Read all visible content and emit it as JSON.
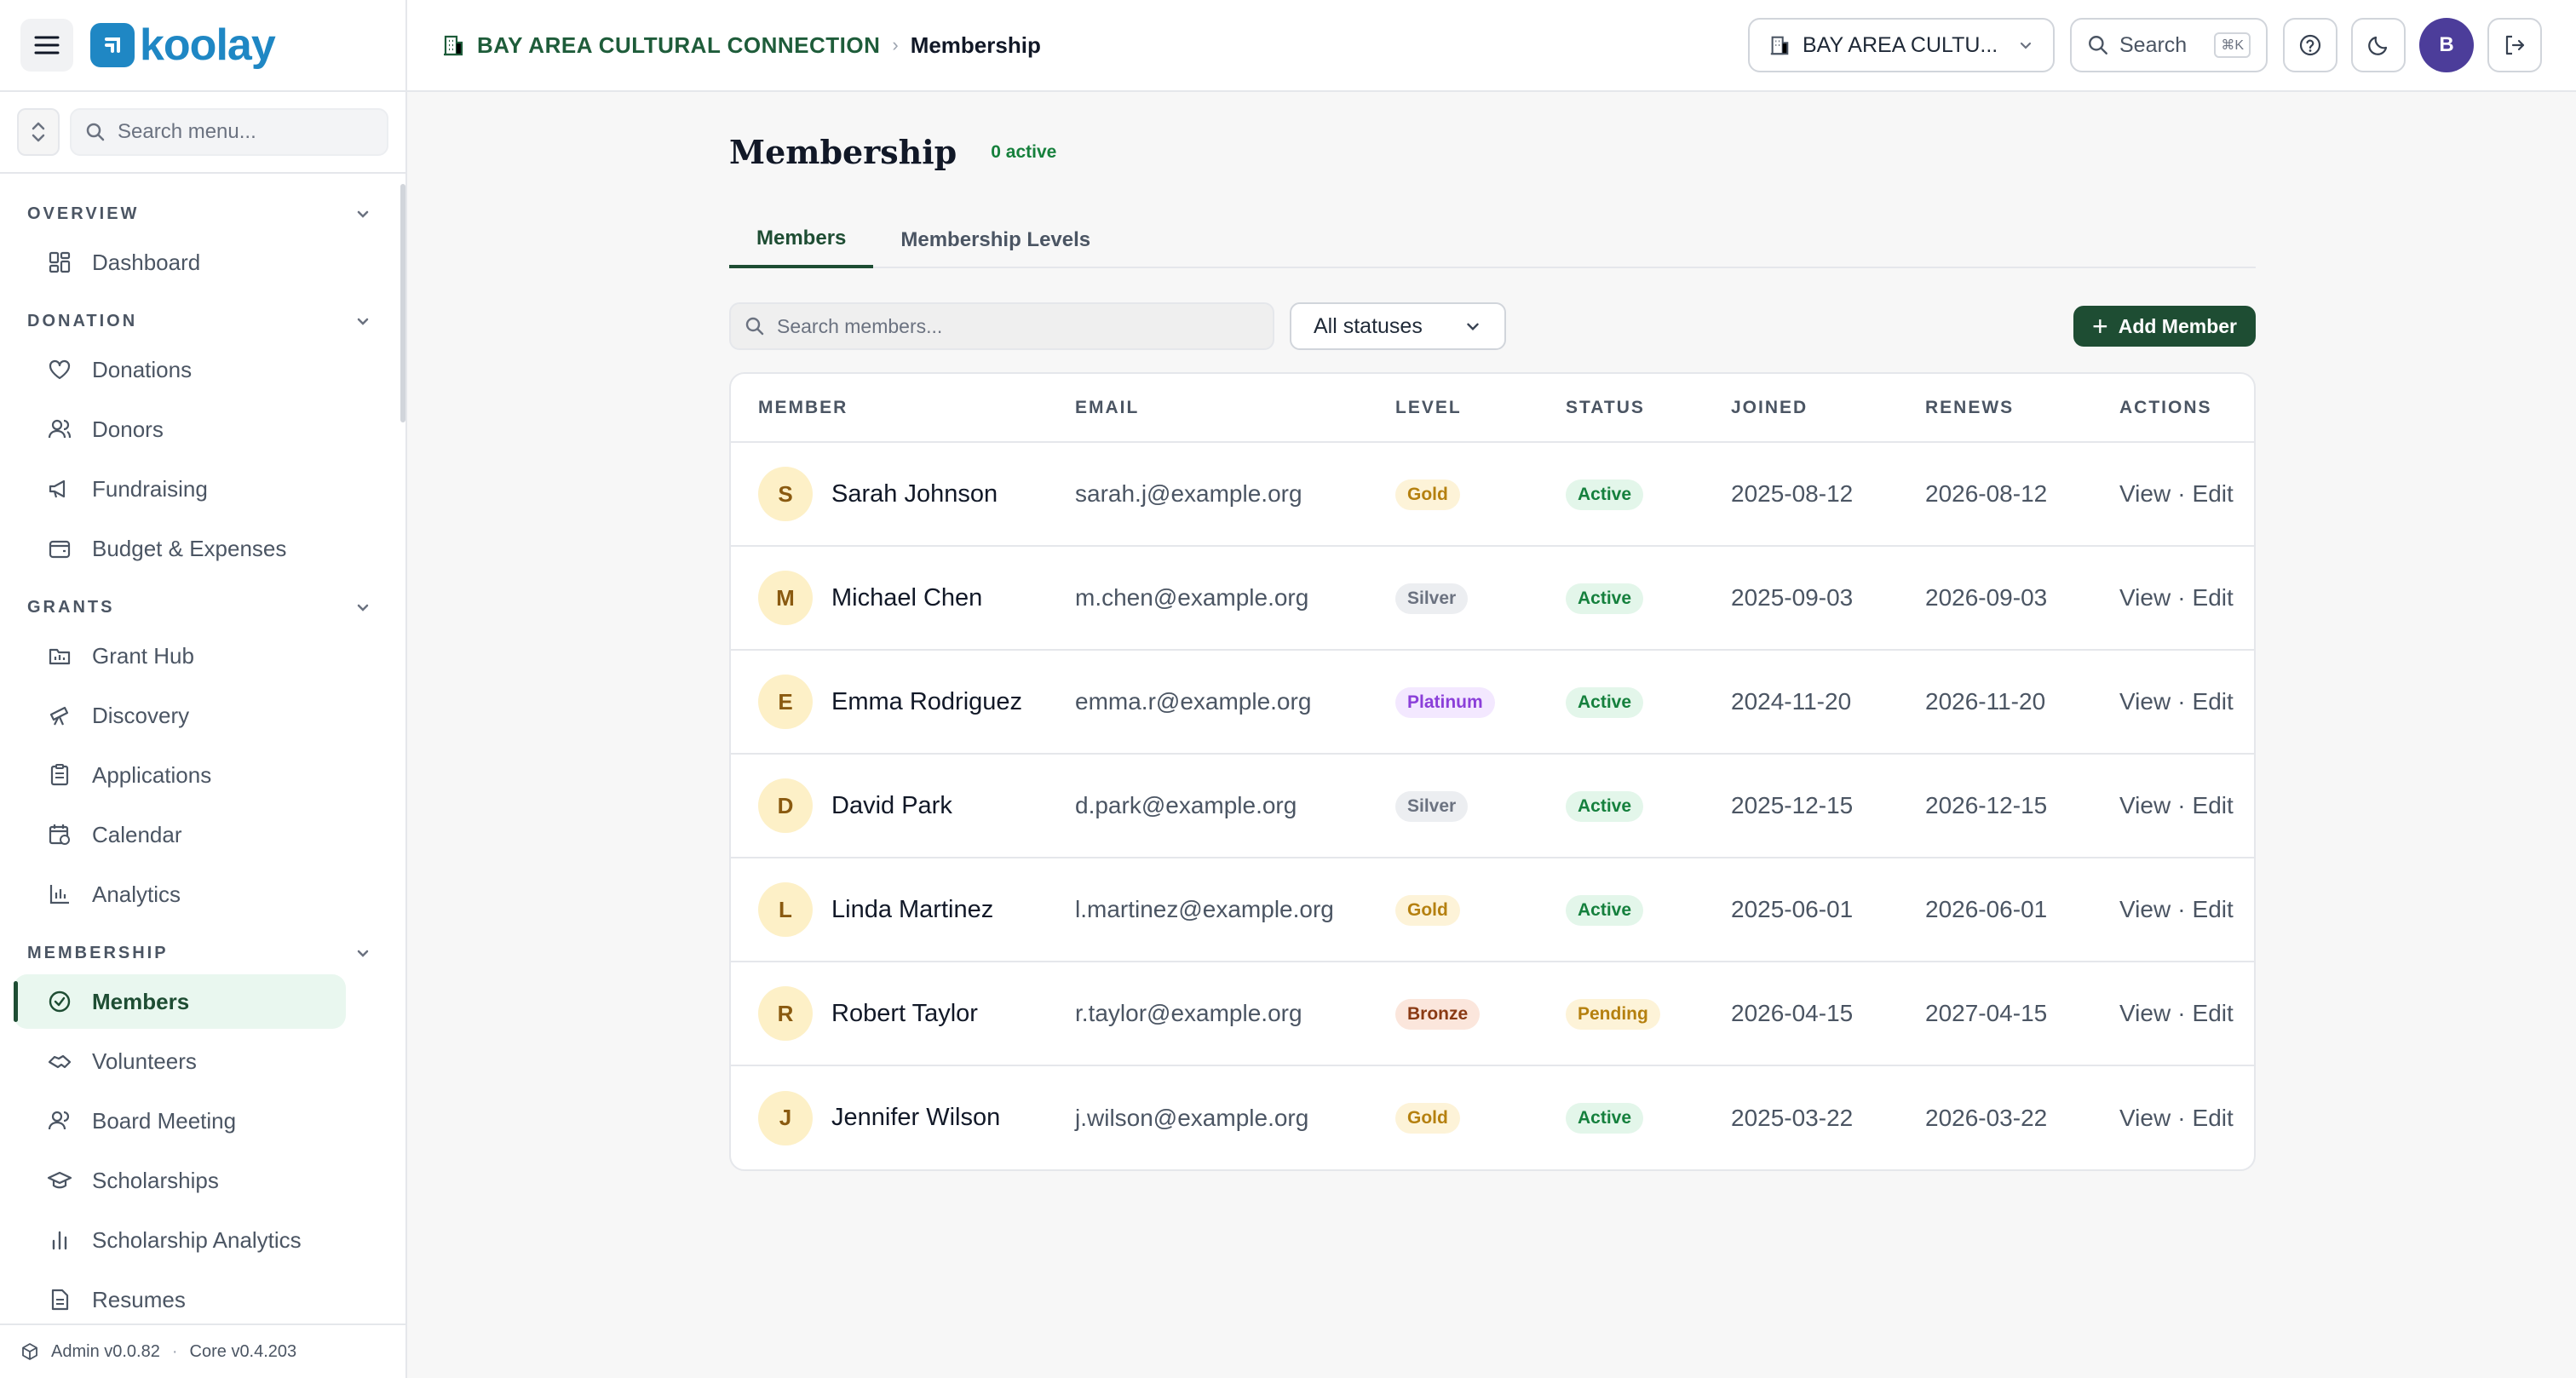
{
  "brand": {
    "name": "koolay"
  },
  "sidebar": {
    "search_placeholder": "Search menu...",
    "sections": [
      {
        "title": "OVERVIEW",
        "items": [
          {
            "label": "Dashboard"
          }
        ]
      },
      {
        "title": "DONATION",
        "items": [
          {
            "label": "Donations"
          },
          {
            "label": "Donors"
          },
          {
            "label": "Fundraising"
          },
          {
            "label": "Budget & Expenses"
          }
        ]
      },
      {
        "title": "GRANTS",
        "items": [
          {
            "label": "Grant Hub"
          },
          {
            "label": "Discovery"
          },
          {
            "label": "Applications"
          },
          {
            "label": "Calendar"
          },
          {
            "label": "Analytics"
          }
        ]
      },
      {
        "title": "MEMBERSHIP",
        "items": [
          {
            "label": "Members"
          },
          {
            "label": "Volunteers"
          },
          {
            "label": "Board Meeting"
          },
          {
            "label": "Scholarships"
          },
          {
            "label": "Scholarship Analytics"
          },
          {
            "label": "Resumes"
          }
        ]
      }
    ],
    "footer": {
      "admin_version": "Admin v0.0.82",
      "core_version": "Core v0.4.203"
    }
  },
  "topbar": {
    "breadcrumb_org": "BAY AREA CULTURAL CONNECTION",
    "breadcrumb_page": "Membership",
    "org_select": "BAY AREA CULTU...",
    "search_label": "Search",
    "search_shortcut": "⌘K",
    "avatar_initial": "B"
  },
  "page": {
    "title": "Membership",
    "active_count": "0 active",
    "tabs": [
      {
        "label": "Members"
      },
      {
        "label": "Membership Levels"
      }
    ],
    "member_search_placeholder": "Search members...",
    "status_filter": "All statuses",
    "add_member_label": "Add Member"
  },
  "table": {
    "headers": [
      "MEMBER",
      "EMAIL",
      "LEVEL",
      "STATUS",
      "JOINED",
      "RENEWS",
      "ACTIONS"
    ],
    "rows": [
      {
        "initial": "S",
        "name": "Sarah Johnson",
        "email": "sarah.j@example.org",
        "level": "Gold",
        "status": "Active",
        "joined": "2025-08-12",
        "renews": "2026-08-12"
      },
      {
        "initial": "M",
        "name": "Michael Chen",
        "email": "m.chen@example.org",
        "level": "Silver",
        "status": "Active",
        "joined": "2025-09-03",
        "renews": "2026-09-03"
      },
      {
        "initial": "E",
        "name": "Emma Rodriguez",
        "email": "emma.r@example.org",
        "level": "Platinum",
        "status": "Active",
        "joined": "2024-11-20",
        "renews": "2026-11-20"
      },
      {
        "initial": "D",
        "name": "David Park",
        "email": "d.park@example.org",
        "level": "Silver",
        "status": "Active",
        "joined": "2025-12-15",
        "renews": "2026-12-15"
      },
      {
        "initial": "L",
        "name": "Linda Martinez",
        "email": "l.martinez@example.org",
        "level": "Gold",
        "status": "Active",
        "joined": "2025-06-01",
        "renews": "2026-06-01"
      },
      {
        "initial": "R",
        "name": "Robert Taylor",
        "email": "r.taylor@example.org",
        "level": "Bronze",
        "status": "Pending",
        "joined": "2026-04-15",
        "renews": "2027-04-15"
      },
      {
        "initial": "J",
        "name": "Jennifer Wilson",
        "email": "j.wilson@example.org",
        "level": "Gold",
        "status": "Active",
        "joined": "2025-03-22",
        "renews": "2026-03-22"
      }
    ],
    "action_view": "View",
    "action_edit": "Edit",
    "action_sep": "·"
  },
  "colors": {
    "accent": "#1e4d33",
    "brand": "#1f87c4",
    "level_gold": {
      "bg": "#fdf3d8",
      "fg": "#b5800f"
    },
    "level_silver": {
      "bg": "#eceef1",
      "fg": "#6b7280"
    },
    "level_platinum": {
      "bg": "#f3e8ff",
      "fg": "#8b3fd9"
    },
    "level_bronze": {
      "bg": "#fbe6dc",
      "fg": "#8a3a14"
    },
    "status_active": {
      "bg": "#e3f6ea",
      "fg": "#15803d"
    },
    "status_pending": {
      "bg": "#fdf3d8",
      "fg": "#b5800f"
    }
  }
}
